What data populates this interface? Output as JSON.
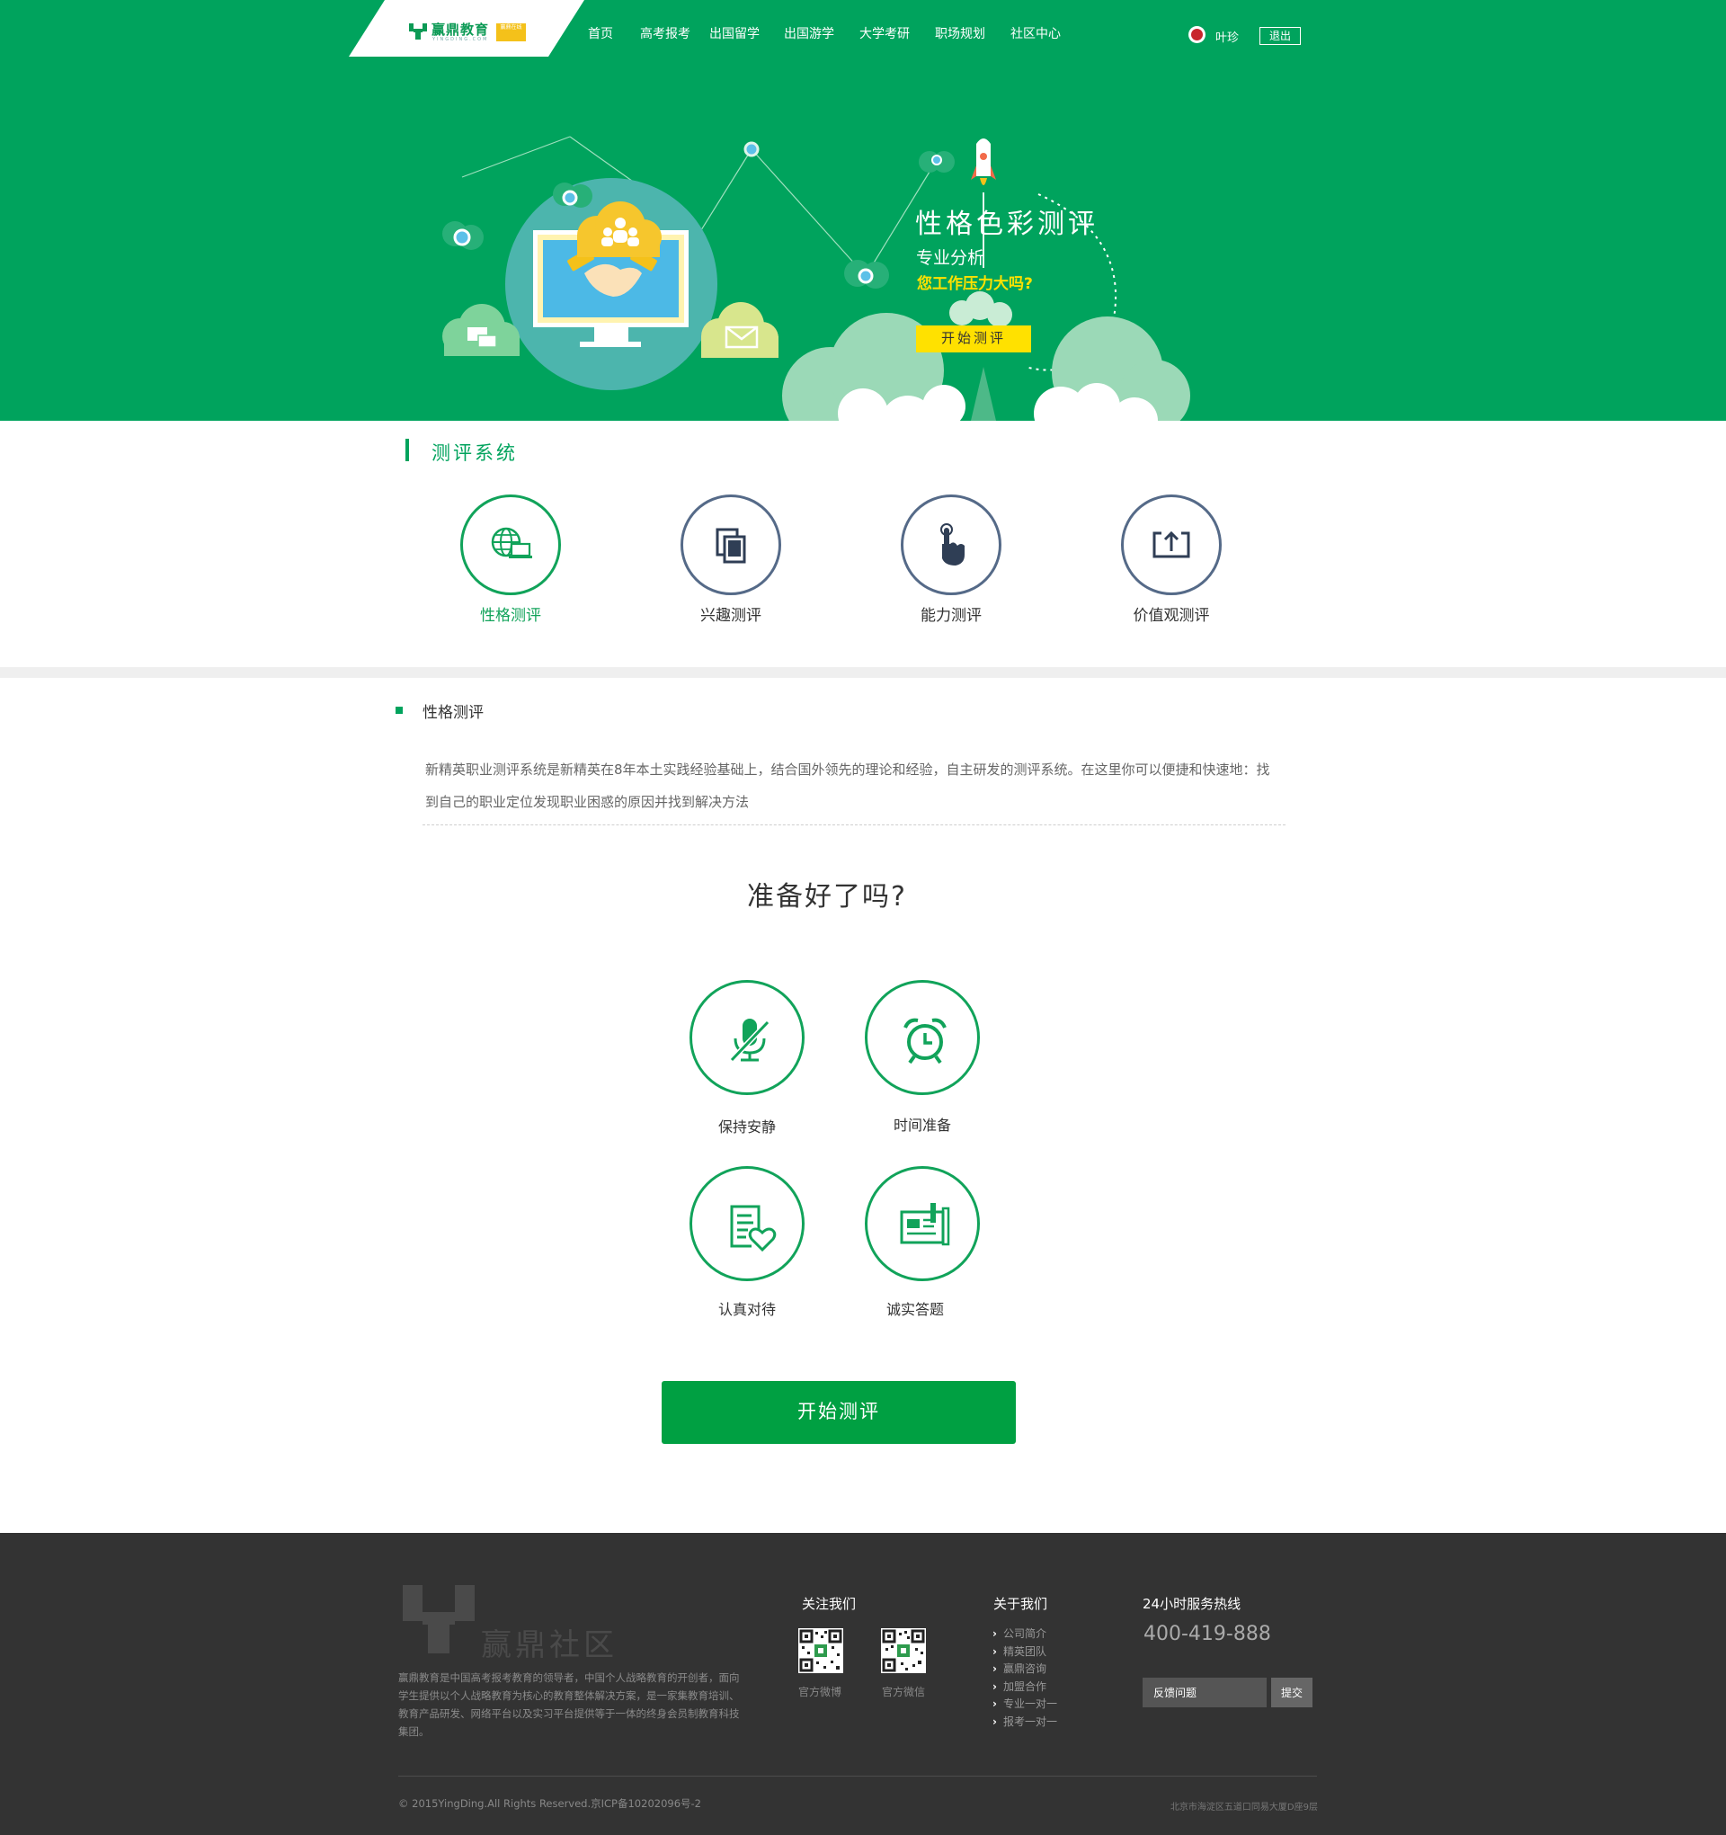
{
  "header": {
    "logo_text": "赢鼎教育",
    "logo_sub": "YINGDING.COM",
    "logo_badge": "赢鼎在线",
    "nav": [
      "首页",
      "高考报考",
      "出国留学",
      "出国游学",
      "大学考研",
      "职场规划",
      "社区中心"
    ],
    "user_name": "叶珍",
    "logout_label": "退出"
  },
  "hero": {
    "title": "性格色彩测评",
    "subtitle": "专业分析",
    "question": "您工作压力大吗?",
    "button": "开始测评"
  },
  "system": {
    "title": "测评系统",
    "categories": [
      {
        "label": "性格测评",
        "icon": "globe-laptop-icon",
        "active": true
      },
      {
        "label": "兴趣测评",
        "icon": "devices-icon",
        "active": false
      },
      {
        "label": "能力测评",
        "icon": "hand-pointer-icon",
        "active": false
      },
      {
        "label": "价值观测评",
        "icon": "upload-frame-icon",
        "active": false
      }
    ]
  },
  "detail": {
    "heading": "性格测评",
    "text": "新精英职业测评系统是新精英在8年本土实践经验基础上，结合国外领先的理论和经验，自主研发的测评系统。在这里你可以便捷和快速地：找到自己的职业定位发现职业困惑的原因并找到解决方法"
  },
  "ready": {
    "title": "准备好了吗?",
    "tips": [
      {
        "label": "保持安静",
        "icon": "mute-mic-icon"
      },
      {
        "label": "时间准备",
        "icon": "alarm-clock-icon"
      },
      {
        "label": "认真对待",
        "icon": "document-heart-icon"
      },
      {
        "label": "诚实答题",
        "icon": "newspaper-pen-icon"
      }
    ],
    "start_button": "开始测评"
  },
  "footer": {
    "brand": "赢鼎社区",
    "description": "赢鼎教育是中国高考报考教育的领导者，中国个人战略教育的开创者，面向学生提供以个人战略教育为核心的教育整体解决方案，是一家集教育培训、教育产品研发、网络平台以及实习平台提供等于一体的终身会员制教育科技集团。",
    "follow_title": "关注我们",
    "qr_weibo": "官方微博",
    "qr_wechat": "官方微信",
    "about_title": "关于我们",
    "about_links": [
      "公司简介",
      "精英团队",
      "赢鼎咨询",
      "加盟合作",
      "专业一对一",
      "报考一对一"
    ],
    "hotline_title": "24小时服务热线",
    "hotline": "400-419-888",
    "feedback_placeholder": "反馈问题",
    "submit_label": "提交",
    "copyright": "© 2015YingDing.All Rights Reserved.京ICP备10202096号-2",
    "address": "北京市海淀区五道口同易大厦D座9层"
  },
  "colors": {
    "brand_green": "#00a35d",
    "button_green": "#00a042",
    "accent_yellow": "#ffe100",
    "inactive_ring": "#556a88",
    "footer_bg": "#333333"
  }
}
